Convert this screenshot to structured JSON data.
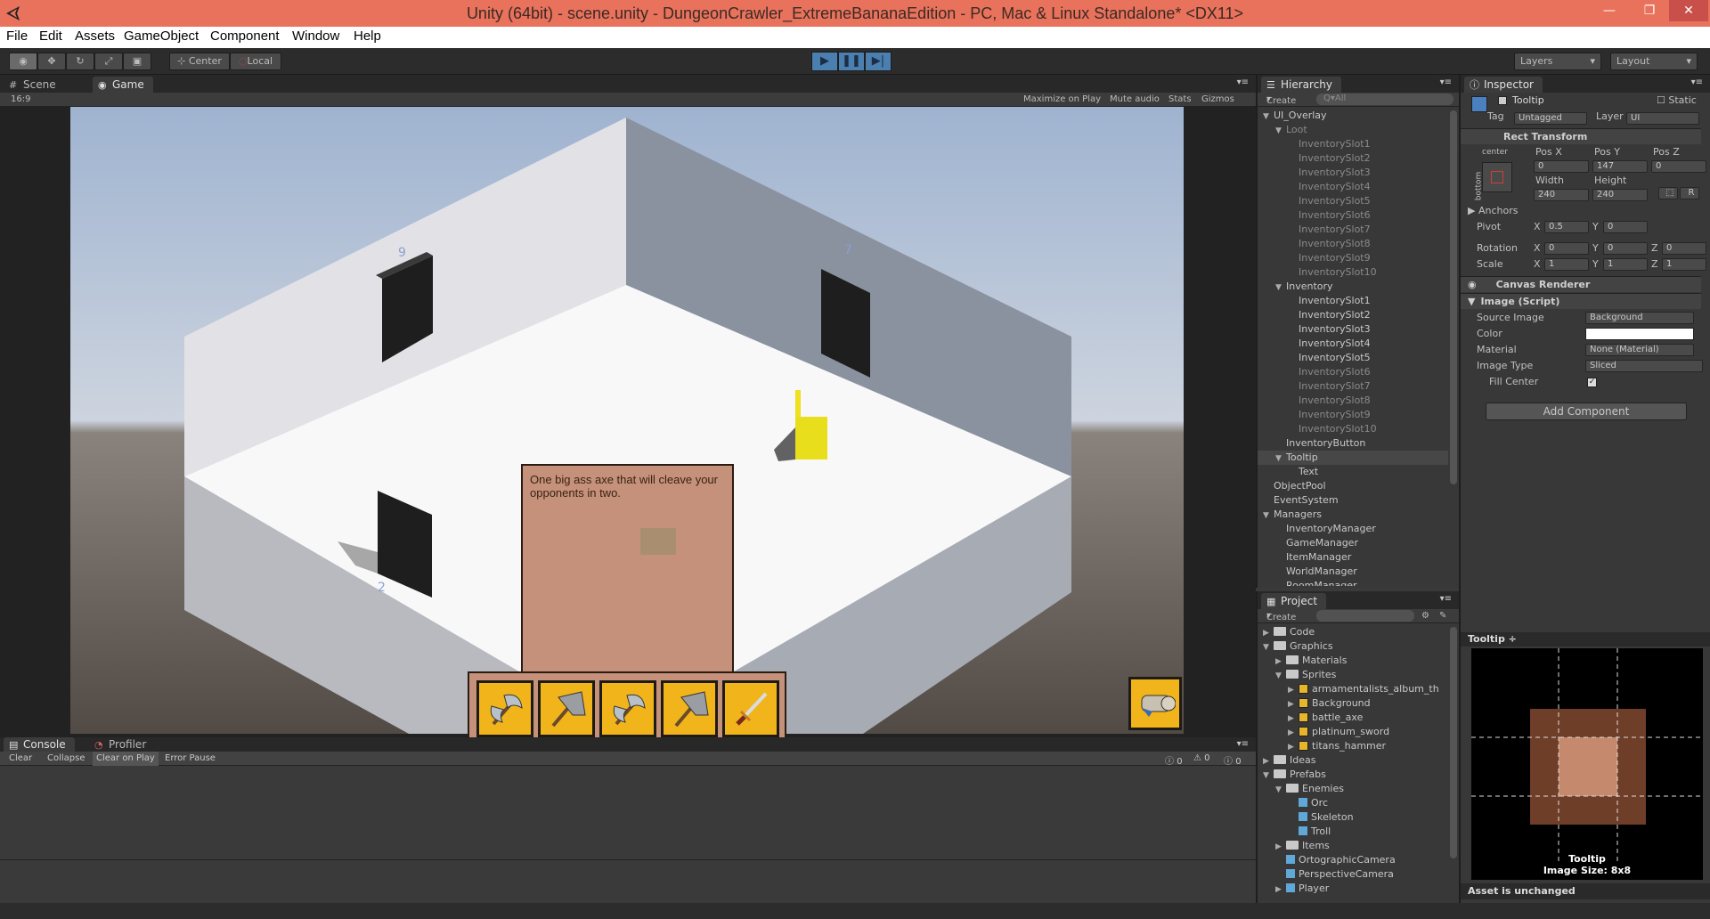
{
  "window": {
    "title": "Unity (64bit) - scene.unity - DungeonCrawler_ExtremeBananaEdition - PC, Mac & Linux Standalone* <DX11>",
    "controls": [
      "—",
      "❐",
      "✕"
    ]
  },
  "menu": [
    "File",
    "Edit",
    "Assets",
    "GameObject",
    "Component",
    "Window",
    "Help"
  ],
  "toolbar": {
    "pivot_center": "Center",
    "pivot_local": "Local",
    "layers": "Layers",
    "layout": "Layout"
  },
  "game_view": {
    "tabs": [
      "Scene",
      "Game"
    ],
    "aspect": "16:9",
    "options": [
      "Maximize on Play",
      "Mute audio",
      "Stats",
      "Gizmos"
    ],
    "tooltip_text": "One big ass axe that will cleave your opponents in two.",
    "door_labels": [
      "9",
      "7",
      "2"
    ]
  },
  "hierarchy": {
    "tab": "Hierarchy",
    "create": "Create",
    "search_placeholder": "Q▾All",
    "items": [
      {
        "label": "UI_Overlay",
        "indent": 0,
        "arrow": "▼"
      },
      {
        "label": "Loot",
        "indent": 1,
        "arrow": "▼",
        "dim": true
      },
      {
        "label": "InventorySlot1",
        "indent": 2,
        "dim": true
      },
      {
        "label": "InventorySlot2",
        "indent": 2,
        "dim": true
      },
      {
        "label": "InventorySlot3",
        "indent": 2,
        "dim": true
      },
      {
        "label": "InventorySlot4",
        "indent": 2,
        "dim": true
      },
      {
        "label": "InventorySlot5",
        "indent": 2,
        "dim": true
      },
      {
        "label": "InventorySlot6",
        "indent": 2,
        "dim": true
      },
      {
        "label": "InventorySlot7",
        "indent": 2,
        "dim": true
      },
      {
        "label": "InventorySlot8",
        "indent": 2,
        "dim": true
      },
      {
        "label": "InventorySlot9",
        "indent": 2,
        "dim": true
      },
      {
        "label": "InventorySlot10",
        "indent": 2,
        "dim": true
      },
      {
        "label": "Inventory",
        "indent": 1,
        "arrow": "▼"
      },
      {
        "label": "InventorySlot1",
        "indent": 2
      },
      {
        "label": "InventorySlot2",
        "indent": 2
      },
      {
        "label": "InventorySlot3",
        "indent": 2
      },
      {
        "label": "InventorySlot4",
        "indent": 2
      },
      {
        "label": "InventorySlot5",
        "indent": 2
      },
      {
        "label": "InventorySlot6",
        "indent": 2,
        "dim": true
      },
      {
        "label": "InventorySlot7",
        "indent": 2,
        "dim": true
      },
      {
        "label": "InventorySlot8",
        "indent": 2,
        "dim": true
      },
      {
        "label": "InventorySlot9",
        "indent": 2,
        "dim": true
      },
      {
        "label": "InventorySlot10",
        "indent": 2,
        "dim": true
      },
      {
        "label": "InventoryButton",
        "indent": 1
      },
      {
        "label": "Tooltip",
        "indent": 1,
        "arrow": "▼",
        "selected": true
      },
      {
        "label": "Text",
        "indent": 2
      },
      {
        "label": "ObjectPool",
        "indent": 0
      },
      {
        "label": "EventSystem",
        "indent": 0
      },
      {
        "label": "Managers",
        "indent": 0,
        "arrow": "▼"
      },
      {
        "label": "InventoryManager",
        "indent": 1
      },
      {
        "label": "GameManager",
        "indent": 1
      },
      {
        "label": "ItemManager",
        "indent": 1
      },
      {
        "label": "WorldManager",
        "indent": 1
      },
      {
        "label": "RoomManager",
        "indent": 1
      }
    ]
  },
  "project": {
    "tab": "Project",
    "create": "Create",
    "items": [
      {
        "label": "Code",
        "indent": 0,
        "arrow": "▶",
        "kind": "folder"
      },
      {
        "label": "Graphics",
        "indent": 0,
        "arrow": "▼",
        "kind": "folder"
      },
      {
        "label": "Materials",
        "indent": 1,
        "arrow": "▶",
        "kind": "folder"
      },
      {
        "label": "Sprites",
        "indent": 1,
        "arrow": "▼",
        "kind": "folder"
      },
      {
        "label": "armamentalists_album_th",
        "indent": 2,
        "arrow": "▶",
        "kind": "sprite"
      },
      {
        "label": "Background",
        "indent": 2,
        "arrow": "▶",
        "kind": "sprite"
      },
      {
        "label": "battle_axe",
        "indent": 2,
        "arrow": "▶",
        "kind": "sprite"
      },
      {
        "label": "platinum_sword",
        "indent": 2,
        "arrow": "▶",
        "kind": "sprite"
      },
      {
        "label": "titans_hammer",
        "indent": 2,
        "arrow": "▶",
        "kind": "sprite"
      },
      {
        "label": "Ideas",
        "indent": 0,
        "arrow": "▶",
        "kind": "folder"
      },
      {
        "label": "Prefabs",
        "indent": 0,
        "arrow": "▼",
        "kind": "folder"
      },
      {
        "label": "Enemies",
        "indent": 1,
        "arrow": "▼",
        "kind": "folder"
      },
      {
        "label": "Orc",
        "indent": 2,
        "kind": "cube"
      },
      {
        "label": "Skeleton",
        "indent": 2,
        "kind": "cube"
      },
      {
        "label": "Troll",
        "indent": 2,
        "kind": "cube"
      },
      {
        "label": "Items",
        "indent": 1,
        "arrow": "▶",
        "kind": "folder"
      },
      {
        "label": "OrtographicCamera",
        "indent": 1,
        "kind": "cube"
      },
      {
        "label": "PerspectiveCamera",
        "indent": 1,
        "kind": "cube"
      },
      {
        "label": "Player",
        "indent": 1,
        "arrow": "▶",
        "kind": "cube"
      }
    ]
  },
  "inspector": {
    "tab": "Inspector",
    "object_name": "Tooltip",
    "static": "Static",
    "tag_label": "Tag",
    "tag_value": "Untagged",
    "layer_label": "Layer",
    "layer_value": "UI",
    "rect_transform": "Rect Transform",
    "anchor_h": "center",
    "anchor_v": "bottom",
    "pos_x_label": "Pos X",
    "pos_y_label": "Pos Y",
    "pos_z_label": "Pos Z",
    "pos_x": "0",
    "pos_y": "147",
    "pos_z": "0",
    "width_label": "Width",
    "height_label": "Height",
    "width": "240",
    "height": "240",
    "r_btn": "R",
    "anchors": "Anchors",
    "pivot": "Pivot",
    "pivot_x": "0.5",
    "pivot_y": "0",
    "rotation": "Rotation",
    "rot_x": "0",
    "rot_y": "0",
    "rot_z": "0",
    "scale": "Scale",
    "scale_x": "1",
    "scale_y": "1",
    "scale_z": "1",
    "x": "X",
    "y": "Y",
    "z": "Z",
    "canvas_renderer": "Canvas Renderer",
    "image_script": "Image (Script)",
    "source_image_label": "Source Image",
    "source_image": "Background",
    "color_label": "Color",
    "material_label": "Material",
    "material": "None (Material)",
    "image_type_label": "Image Type",
    "image_type": "Sliced",
    "fill_center_label": "Fill Center",
    "add_component": "Add Component",
    "preview_title": "Tooltip ÷",
    "preview_caption_1": "Tooltip",
    "preview_caption_2": "Image Size: 8x8",
    "asset_status": "Asset is unchanged"
  },
  "console": {
    "tabs": [
      "Console",
      "Profiler"
    ],
    "buttons": [
      "Clear",
      "Collapse",
      "Clear on Play",
      "Error Pause"
    ],
    "counts": [
      "0",
      "0",
      "0"
    ]
  }
}
